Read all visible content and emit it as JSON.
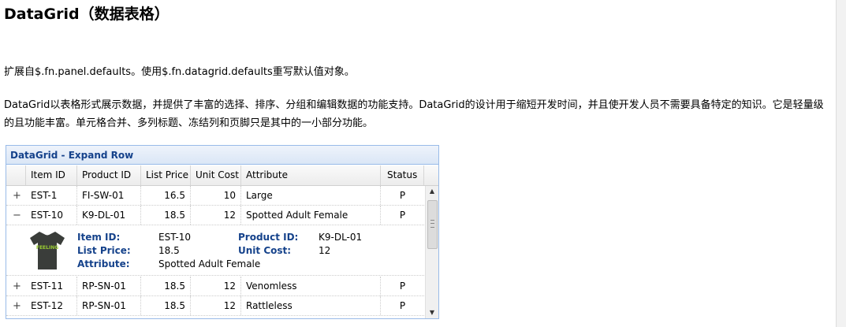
{
  "page": {
    "title": "DataGrid（数据表格）",
    "para1": "扩展自$.fn.panel.defaults。使用$.fn.datagrid.defaults重写默认值对象。",
    "para2": "DataGrid以表格形式展示数据，并提供了丰富的选择、排序、分组和编辑数据的功能支持。DataGrid的设计用于缩短开发时间，并且使开发人员不需要具备特定的知识。它是轻量级的且功能丰富。单元格合并、多列标题、冻结列和页脚只是其中的一小部分功能。"
  },
  "panel": {
    "title": "DataGrid - Expand Row"
  },
  "columns": [
    "Item ID",
    "Product ID",
    "List Price",
    "Unit Cost",
    "Attribute",
    "Status"
  ],
  "rows": [
    {
      "expander": "+",
      "item_id": "EST-1",
      "product_id": "FI-SW-01",
      "list_price": "16.5",
      "unit_cost": "10",
      "attribute": "Large",
      "status": "P"
    },
    {
      "expander": "−",
      "item_id": "EST-10",
      "product_id": "K9-DL-01",
      "list_price": "18.5",
      "unit_cost": "12",
      "attribute": "Spotted Adult Female",
      "status": "P"
    },
    {
      "expander": "+",
      "item_id": "EST-11",
      "product_id": "RP-SN-01",
      "list_price": "18.5",
      "unit_cost": "12",
      "attribute": "Venomless",
      "status": "P"
    },
    {
      "expander": "+",
      "item_id": "EST-12",
      "product_id": "RP-SN-01",
      "list_price": "18.5",
      "unit_cost": "12",
      "attribute": "Rattleless",
      "status": "P"
    }
  ],
  "detail": {
    "labels": {
      "item_id": "Item ID:",
      "product_id": "Product ID:",
      "list_price": "List Price:",
      "unit_cost": "Unit Cost:",
      "attribute": "Attribute:"
    },
    "values": {
      "item_id": "EST-10",
      "product_id": "K9-DL-01",
      "list_price": "18.5",
      "unit_cost": "12",
      "attribute": "Spotted Adult Female"
    },
    "image_text": "FEELING",
    "image_color": "#3a3d3a",
    "image_text_color": "#9acd32"
  },
  "icons": {
    "expand": "plus-icon",
    "collapse": "minus-icon",
    "scroll_up": "arrow-up-icon",
    "scroll_down": "arrow-down-icon"
  },
  "colors": {
    "header_text": "#15428b",
    "panel_border": "#99bbe8"
  }
}
